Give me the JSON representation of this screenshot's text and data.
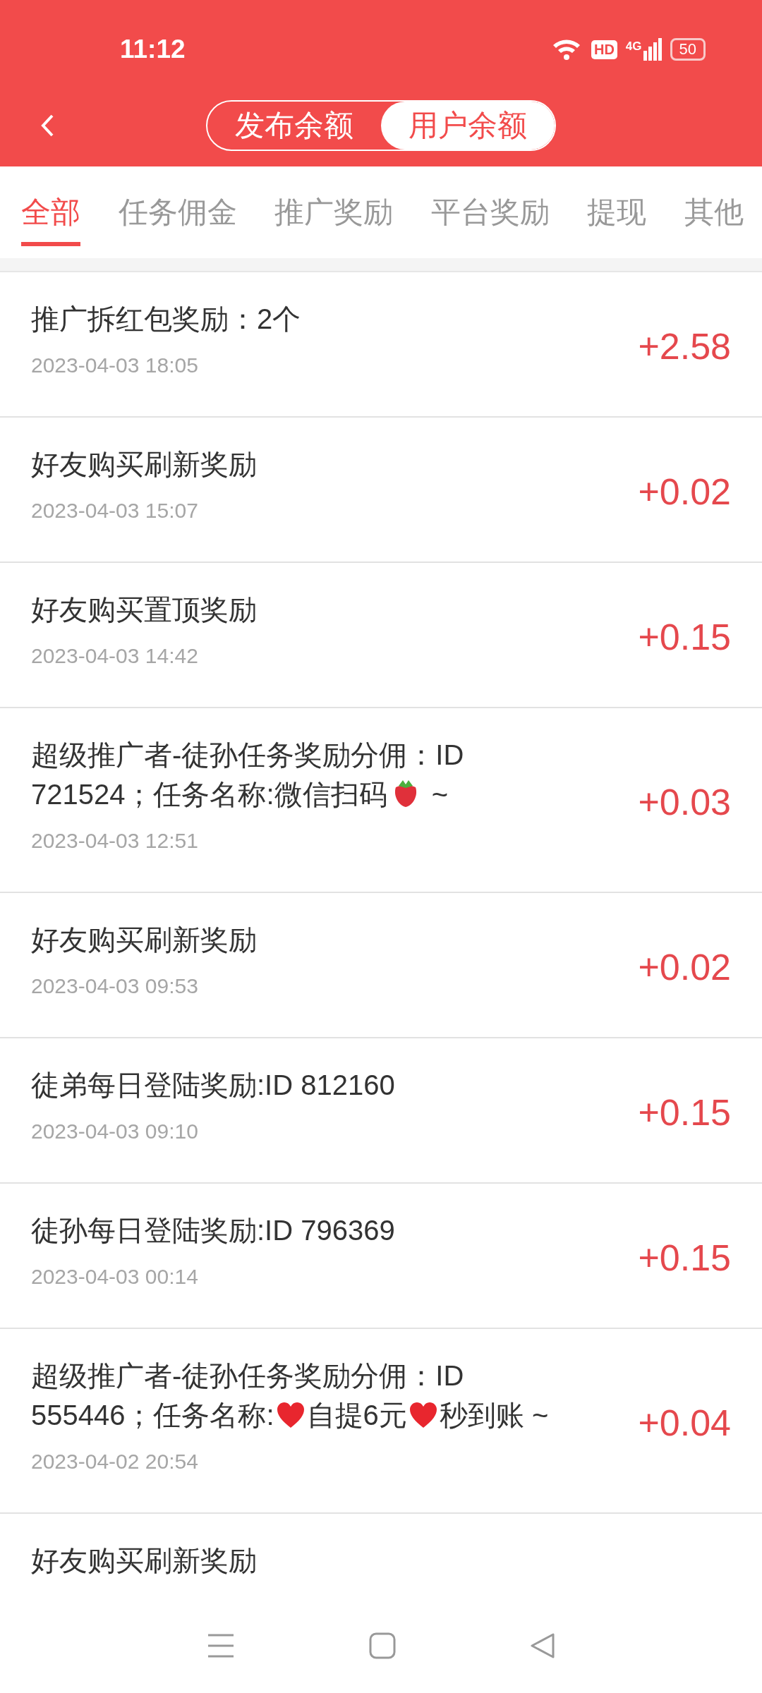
{
  "status_bar": {
    "time": "11:12",
    "hd": "HD",
    "network": "4G",
    "battery": "50"
  },
  "header": {
    "segments": [
      {
        "label": "发布余额",
        "selected": false
      },
      {
        "label": "用户余额",
        "selected": true
      }
    ]
  },
  "tabs": [
    {
      "label": "全部",
      "selected": true
    },
    {
      "label": "任务佣金",
      "selected": false
    },
    {
      "label": "推广奖励",
      "selected": false
    },
    {
      "label": "平台奖励",
      "selected": false
    },
    {
      "label": "提现",
      "selected": false
    },
    {
      "label": "其他",
      "selected": false
    }
  ],
  "records": [
    {
      "title": [
        {
          "kind": "text",
          "text": "推广拆红包奖励：2个"
        }
      ],
      "time": "2023-04-03 18:05",
      "amount": "+2.58"
    },
    {
      "title": [
        {
          "kind": "text",
          "text": "好友购买刷新奖励"
        }
      ],
      "time": "2023-04-03 15:07",
      "amount": "+0.02"
    },
    {
      "title": [
        {
          "kind": "text",
          "text": "好友购买置顶奖励"
        }
      ],
      "time": "2023-04-03 14:42",
      "amount": "+0.15"
    },
    {
      "title": [
        {
          "kind": "text",
          "text": "超级推广者-徒孙任务奖励分佣：ID 721524；任务名称:微信扫码"
        },
        {
          "kind": "strawberry"
        },
        {
          "kind": "text",
          "text": " ~"
        }
      ],
      "time": "2023-04-03 12:51",
      "amount": "+0.03"
    },
    {
      "title": [
        {
          "kind": "text",
          "text": "好友购买刷新奖励"
        }
      ],
      "time": "2023-04-03 09:53",
      "amount": "+0.02"
    },
    {
      "title": [
        {
          "kind": "text",
          "text": "徒弟每日登陆奖励:ID 812160"
        }
      ],
      "time": "2023-04-03 09:10",
      "amount": "+0.15"
    },
    {
      "title": [
        {
          "kind": "text",
          "text": "徒孙每日登陆奖励:ID 796369"
        }
      ],
      "time": "2023-04-03 00:14",
      "amount": "+0.15"
    },
    {
      "title": [
        {
          "kind": "text",
          "text": "超级推广者-徒孙任务奖励分佣：ID 555446；任务名称:"
        },
        {
          "kind": "heart"
        },
        {
          "kind": "text",
          "text": "自提6元"
        },
        {
          "kind": "heart"
        },
        {
          "kind": "text",
          "text": "秒到账 ~"
        }
      ],
      "time": "2023-04-02 20:54",
      "amount": "+0.04"
    },
    {
      "title": [
        {
          "kind": "text",
          "text": "好友购买刷新奖励"
        }
      ]
    }
  ]
}
